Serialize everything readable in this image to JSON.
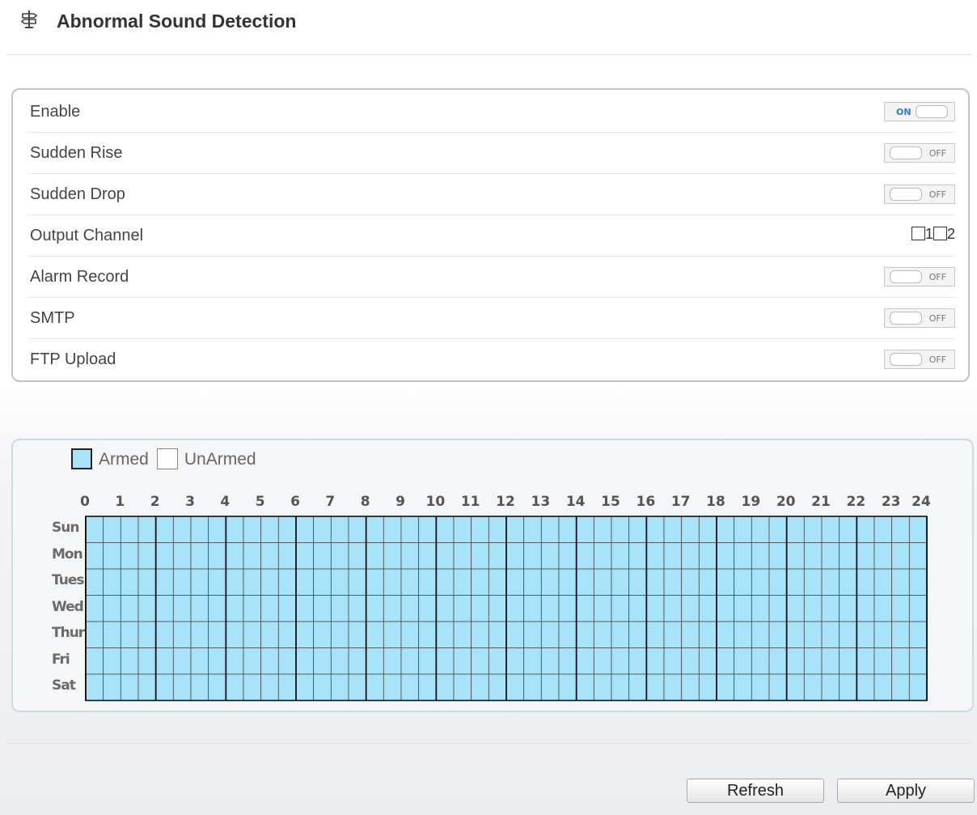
{
  "header": {
    "title": "Abnormal Sound Detection",
    "icon": "signpost-icon"
  },
  "settings": [
    {
      "name": "enable",
      "label": "Enable",
      "control": "toggle",
      "state": "ON"
    },
    {
      "name": "sudden-rise",
      "label": "Sudden Rise",
      "control": "toggle",
      "state": "OFF"
    },
    {
      "name": "sudden-drop",
      "label": "Sudden Drop",
      "control": "toggle",
      "state": "OFF"
    },
    {
      "name": "output-channel",
      "label": "Output Channel",
      "control": "checkboxes",
      "options": [
        "1",
        "2"
      ],
      "checked": [
        false,
        false
      ]
    },
    {
      "name": "alarm-record",
      "label": "Alarm Record",
      "control": "toggle",
      "state": "OFF"
    },
    {
      "name": "smtp",
      "label": "SMTP",
      "control": "toggle",
      "state": "OFF"
    },
    {
      "name": "ftp-upload",
      "label": "FTP Upload",
      "control": "toggle",
      "state": "OFF"
    }
  ],
  "schedule": {
    "legend": {
      "armed": "Armed",
      "unarmed": "UnArmed"
    },
    "hours": [
      "0",
      "1",
      "2",
      "3",
      "4",
      "5",
      "6",
      "7",
      "8",
      "9",
      "10",
      "11",
      "12",
      "13",
      "14",
      "15",
      "16",
      "17",
      "18",
      "19",
      "20",
      "21",
      "22",
      "23",
      "24"
    ],
    "days": [
      "Sun",
      "Mon",
      "Tues",
      "Wed",
      "Thur",
      "Fri",
      "Sat"
    ],
    "slots_per_hour": 2,
    "all_armed": true,
    "armed_color": "#a7e4f9"
  },
  "buttons": {
    "refresh": "Refresh",
    "apply": "Apply"
  }
}
